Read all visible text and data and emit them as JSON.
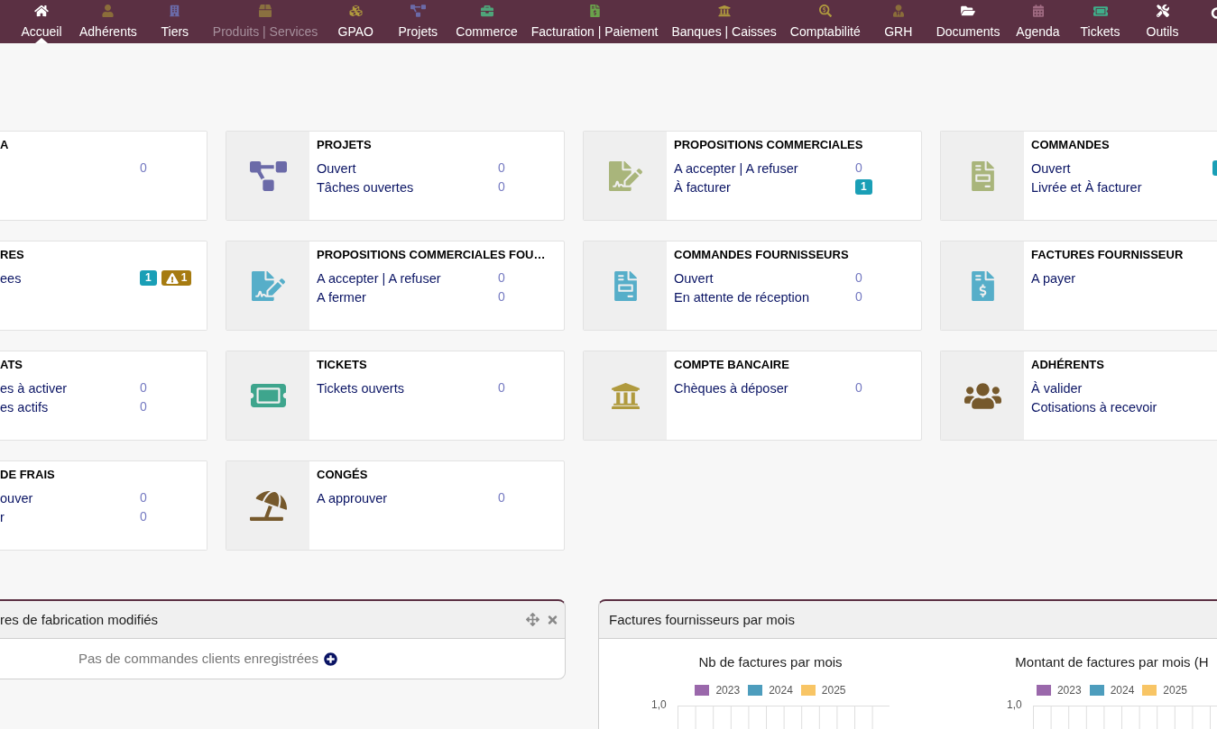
{
  "nav": [
    {
      "label": "Accueil",
      "selected": true,
      "disabled": false
    },
    {
      "label": "Adhérents",
      "selected": false,
      "disabled": false
    },
    {
      "label": "Tiers",
      "selected": false,
      "disabled": false
    },
    {
      "label": "Produits | Services",
      "selected": false,
      "disabled": true
    },
    {
      "label": "GPAO",
      "selected": false,
      "disabled": false
    },
    {
      "label": "Projets",
      "selected": false,
      "disabled": false
    },
    {
      "label": "Commerce",
      "selected": false,
      "disabled": false
    },
    {
      "label": "Facturation | Paiement",
      "selected": false,
      "disabled": false
    },
    {
      "label": "Banques | Caisses",
      "selected": false,
      "disabled": false
    },
    {
      "label": "Comptabilité",
      "selected": false,
      "disabled": false
    },
    {
      "label": "GRH",
      "selected": false,
      "disabled": false
    },
    {
      "label": "Documents",
      "selected": false,
      "disabled": false
    },
    {
      "label": "Agenda",
      "selected": false,
      "disabled": false
    },
    {
      "label": "Tickets",
      "selected": false,
      "disabled": false
    },
    {
      "label": "Outils",
      "selected": false,
      "disabled": false
    }
  ],
  "boxes": [
    {
      "title": "A",
      "rows": [
        {
          "count": "0"
        }
      ]
    },
    {
      "title": "PROJETS",
      "rows": [
        {
          "label": "Ouvert",
          "count": "0"
        },
        {
          "label": "Tâches ouvertes",
          "count": "0"
        }
      ]
    },
    {
      "title": "PROPOSITIONS COMMERCIALES",
      "rows": [
        {
          "label": "A accepter | A refuser",
          "count": "0"
        },
        {
          "label": "À facturer",
          "badges": [
            {
              "kind": "info",
              "text": "1"
            }
          ]
        }
      ]
    },
    {
      "title": "COMMANDES",
      "rows": [
        {
          "label": "Ouvert",
          "badges": [
            {
              "kind": "info"
            }
          ]
        },
        {
          "label": "Livrée et À facturer"
        }
      ]
    },
    {
      "title": "RES",
      "rows": [
        {
          "label": "ees",
          "badges": [
            {
              "kind": "info",
              "text": "1"
            },
            {
              "kind": "warning",
              "text": "1"
            }
          ]
        }
      ]
    },
    {
      "title": "PROPOSITIONS COMMERCIALES FOU…",
      "rows": [
        {
          "label": "A accepter | A refuser",
          "count": "0"
        },
        {
          "label": "A fermer",
          "count": "0"
        }
      ]
    },
    {
      "title": "COMMANDES FOURNISSEURS",
      "rows": [
        {
          "label": "Ouvert",
          "count": "0"
        },
        {
          "label": "En attente de réception",
          "count": "0"
        }
      ]
    },
    {
      "title": "FACTURES FOURNISSEUR",
      "rows": [
        {
          "label": "A payer"
        }
      ]
    },
    {
      "title": "ATS",
      "rows": [
        {
          "label": "es à activer",
          "count": "0"
        },
        {
          "label": "es actifs",
          "count": "0"
        }
      ]
    },
    {
      "title": "TICKETS",
      "rows": [
        {
          "label": "Tickets ouverts",
          "count": "0"
        }
      ]
    },
    {
      "title": "COMPTE BANCAIRE",
      "rows": [
        {
          "label": "Chèques à déposer",
          "count": "0"
        }
      ]
    },
    {
      "title": "ADHÉRENTS",
      "rows": [
        {
          "label": "À valider"
        },
        {
          "label": "Cotisations à recevoir"
        }
      ]
    },
    {
      "title": "DE FRAIS",
      "rows": [
        {
          "label": "ouver",
          "count": "0"
        },
        {
          "label": "r",
          "count": "0"
        }
      ]
    },
    {
      "title": "CONGÉS",
      "rows": [
        {
          "label": "A approuver",
          "count": "0"
        }
      ]
    }
  ],
  "widgets": [
    {
      "kind": "message",
      "title": "res de fabrication modifiés",
      "message": "Pas de commandes clients enregistrées"
    },
    {
      "kind": "charts",
      "title": "Factures fournisseurs par mois",
      "charts": [
        {
          "title": "Nb de factures par mois",
          "legend": [
            {
              "label": "2023",
              "color": "#9a68ab"
            },
            {
              "label": "2024",
              "color": "#4d9dbd"
            },
            {
              "label": "2025",
              "color": "#f8c565"
            }
          ],
          "ytick": "1,0"
        },
        {
          "title": "Montant de factures par mois (H",
          "legend": [
            {
              "label": "2023",
              "color": "#9a68ab"
            },
            {
              "label": "2024",
              "color": "#4d9dbd"
            },
            {
              "label": "2025",
              "color": "#f8c565"
            }
          ],
          "ytick": "1,0"
        }
      ]
    }
  ]
}
